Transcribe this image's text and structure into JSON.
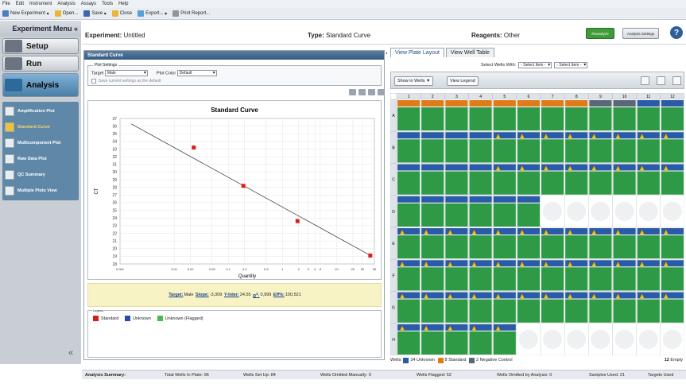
{
  "menubar": {
    "items": [
      "File",
      "Edit",
      "Instrument",
      "Analysis",
      "Assays",
      "Tools",
      "Help"
    ]
  },
  "toolbar": {
    "new_experiment": "New Experiment",
    "open": "Open...",
    "save": "Save",
    "close": "Close",
    "export": "Export...",
    "print_report": "Print Report..."
  },
  "sidebar": {
    "title": "Experiment Menu «",
    "setup": "Setup",
    "run": "Run",
    "analysis": "Analysis",
    "items": [
      {
        "label": "Amplification Plot"
      },
      {
        "label": "Standard Curve",
        "selected": true
      },
      {
        "label": "Multicomponent Plot"
      },
      {
        "label": "Raw Data Plot"
      },
      {
        "label": "QC Summary"
      },
      {
        "label": "Multiple Plots View"
      }
    ]
  },
  "header": {
    "experiment_label": "Experiment:",
    "experiment_value": "Untitled",
    "type_label": "Type:",
    "type_value": "Standard Curve",
    "reagents_label": "Reagents:",
    "reagents_value": "Other",
    "reanalyze": "Reanalyze",
    "analysis_settings": "Analysis Settings"
  },
  "standard_curve": {
    "panel_title": "Standard Curve",
    "plot_settings_title": "Plot Settings",
    "target_label": "Target",
    "target_value": "Male",
    "plot_color_label": "Plot Color",
    "plot_color_value": "Default",
    "save_settings_label": "Save current settings as the default",
    "stats": {
      "target_label": "Target:",
      "target_value": "Male",
      "slope_label": "Slope:",
      "slope_value": "-3,309",
      "yinter_label": "Y-Inter:",
      "yinter_value": "24,55",
      "r2_label": "R",
      "r2_value": "0,999",
      "eff_label": "Eff%:",
      "eff_value": "100,521"
    },
    "legend_title": "Legend",
    "legend": [
      {
        "label": "Standard",
        "color": "#e0191b"
      },
      {
        "label": "Unknown",
        "color": "#2350a0"
      },
      {
        "label": "Unknown (Flagged)",
        "color": "#4db84b"
      }
    ]
  },
  "chart_data": {
    "type": "scatter",
    "title": "Standard Curve",
    "xlabel": "Quantity",
    "ylabel": "CT",
    "xscale": "log",
    "xlim": [
      0.001,
      50
    ],
    "ylim": [
      18,
      37
    ],
    "x_ticks": [
      "0.001",
      "0.01",
      "0.02",
      "0.05",
      "0.1",
      "0.2",
      "0.5",
      "1",
      "2",
      "3",
      "4",
      "5",
      "10",
      "20",
      "30",
      "50"
    ],
    "y_ticks": [
      "18",
      "19",
      "20",
      "21",
      "22",
      "23",
      "24",
      "25",
      "26",
      "27",
      "28",
      "29",
      "30",
      "31",
      "32",
      "33",
      "34",
      "35",
      "36",
      "37"
    ],
    "series": [
      {
        "name": "Standard",
        "points": [
          [
            0.023,
            33.2
          ],
          [
            0.19,
            28.2
          ],
          [
            1.9,
            23.6
          ],
          [
            42,
            19.1
          ]
        ]
      }
    ],
    "fit_line": [
      [
        0.0016,
        36.3
      ],
      [
        45,
        19.0
      ]
    ]
  },
  "right": {
    "tabs": [
      "View Plate Layout",
      "View Well Table"
    ],
    "select_wells_label": "Select Wells With:",
    "select_item_1": "- Select Item -",
    "select_item_2": "- Select Item -",
    "show_in_wells": "Show in Wells ▼",
    "view_legend": "View Legend",
    "columns": [
      "1",
      "2",
      "3",
      "4",
      "5",
      "6",
      "7",
      "8",
      "9",
      "10",
      "11",
      "12"
    ],
    "rows": [
      "A",
      "B",
      "C",
      "D",
      "E",
      "F",
      "G",
      "H"
    ],
    "footer": {
      "wells_label": "Wells:",
      "unknown_count": "34",
      "unknown_label": "Unknown",
      "standard_count": "8",
      "standard_label": "Standard",
      "negative_count": "2",
      "negative_label": "Negative Control",
      "empty_count": "12",
      "empty_label": "Empty"
    }
  },
  "summary": {
    "title": "Analysis Summary:",
    "total": "Total Wells In Plate: 96",
    "setup": "Wells Set Up: 84",
    "omitted_manually": "Wells Omitted Manually: 0",
    "flagged": "Wells Flagged: 52",
    "omitted_analysis": "Wells Omitted by Analysis: 0",
    "samples": "Samples Used: 21",
    "targets": "Targets Used"
  },
  "well_layout": [
    [
      "S",
      "S",
      "S",
      "S",
      "S",
      "S",
      "S",
      "S",
      "N",
      "N",
      "U",
      "U"
    ],
    [
      "U",
      "U",
      "U",
      "U",
      "W",
      "W",
      "W",
      "W",
      "W",
      "W",
      "W",
      "W"
    ],
    [
      "U",
      "U",
      "U",
      "U",
      "W",
      "W",
      "W",
      "W",
      "W",
      "W",
      "W",
      "W"
    ],
    [
      "U",
      "U",
      "U",
      "U",
      "U",
      "U",
      "E",
      "E",
      "E",
      "E",
      "E",
      "E"
    ],
    [
      "W",
      "W",
      "W",
      "W",
      "W",
      "W",
      "W",
      "W",
      "W",
      "W",
      "W",
      "W"
    ],
    [
      "W",
      "W",
      "W",
      "W",
      "W",
      "W",
      "W",
      "W",
      "W",
      "W",
      "W",
      "W"
    ],
    [
      "W",
      "W",
      "W",
      "W",
      "W",
      "W",
      "W",
      "W",
      "W",
      "W",
      "W",
      "W"
    ],
    [
      "W",
      "W",
      "W",
      "W",
      "W",
      "E",
      "E",
      "E",
      "E",
      "E",
      "E",
      "E"
    ]
  ]
}
